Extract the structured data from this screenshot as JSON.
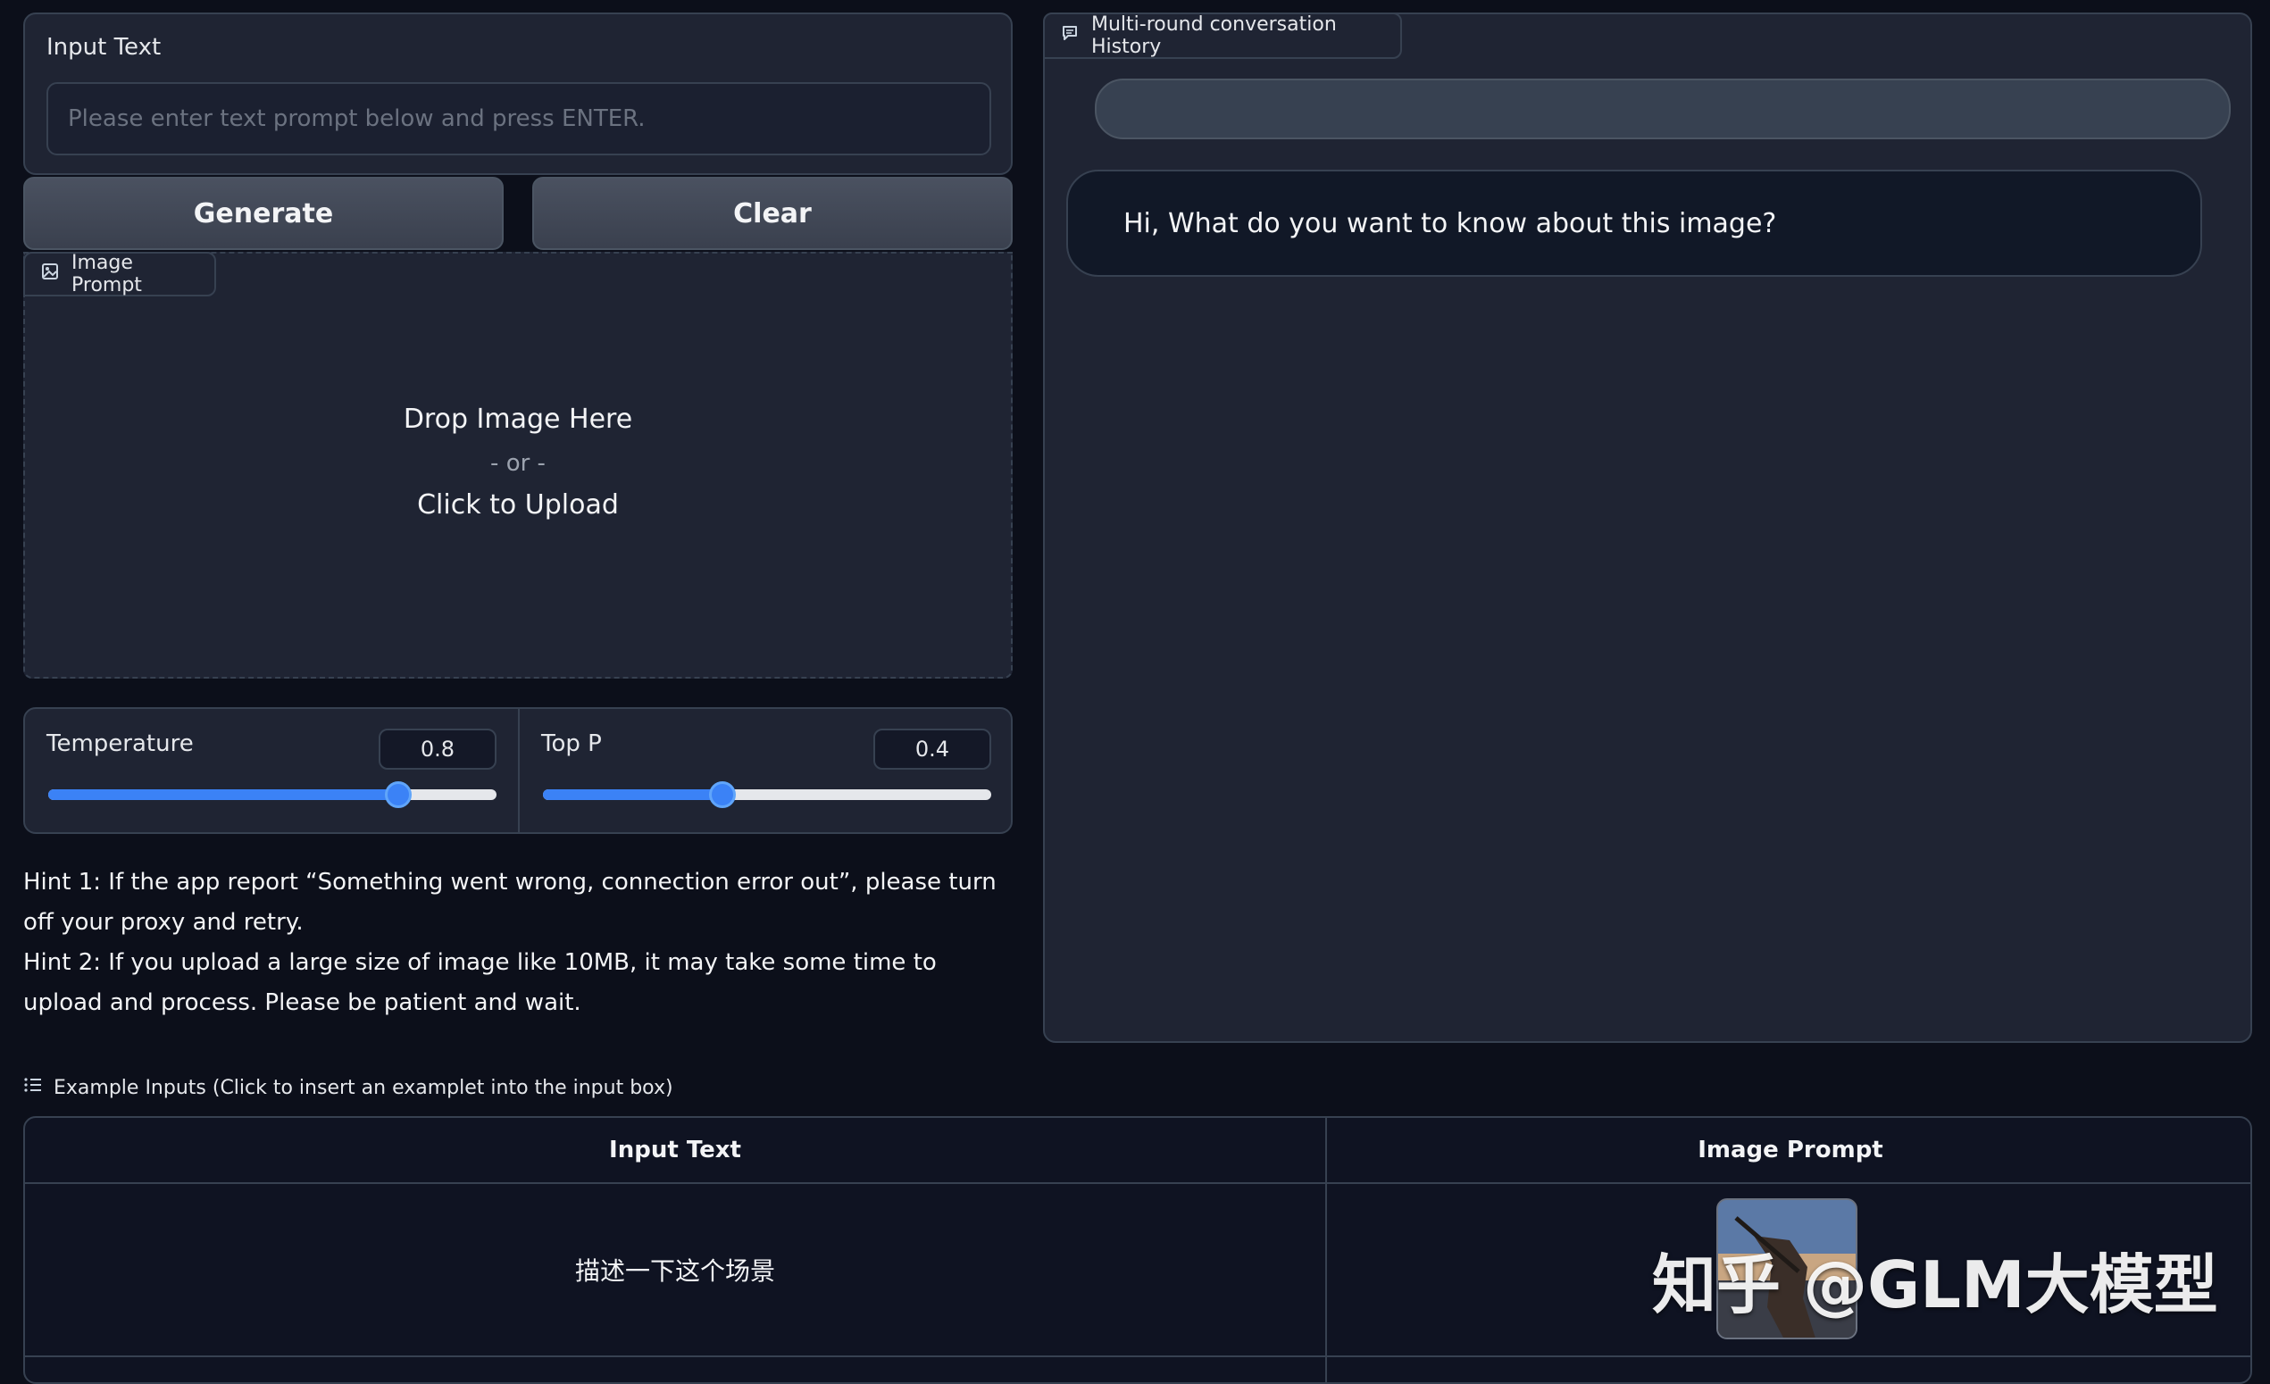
{
  "input_text": {
    "label": "Input Text",
    "placeholder": "Please enter text prompt below and press ENTER.",
    "value": ""
  },
  "buttons": {
    "generate": "Generate",
    "clear": "Clear"
  },
  "image_prompt": {
    "tab_label": "Image Prompt",
    "drop_text": "Drop Image Here",
    "or_text": "- or -",
    "upload_text": "Click to Upload"
  },
  "sliders": {
    "temperature": {
      "label": "Temperature",
      "value": "0.8",
      "fraction": 0.8
    },
    "top_p": {
      "label": "Top P",
      "value": "0.4",
      "fraction": 0.4
    }
  },
  "hints": {
    "hint1": "Hint 1: If the app report “Something went wrong, connection error out”, please turn off your proxy and retry.",
    "hint2": "Hint 2: If you upload a large size of image like 10MB, it may take some time to upload and process. Please be patient and wait."
  },
  "chat": {
    "tab_label": "Multi-round conversation History",
    "user_message": "",
    "bot_message": "Hi, What do you want to know about this image?"
  },
  "examples": {
    "title": "Example Inputs (Click to insert an examplet into the input box)",
    "headers": [
      "Input Text",
      "Image Prompt"
    ],
    "rows": [
      {
        "input_text": "描述一下这个场景"
      }
    ]
  },
  "watermark": "知乎 @GLM大模型",
  "colors": {
    "background": "#0c0f1a",
    "panel": "#1f2433",
    "border": "#374151",
    "accent": "#3b82f6"
  }
}
